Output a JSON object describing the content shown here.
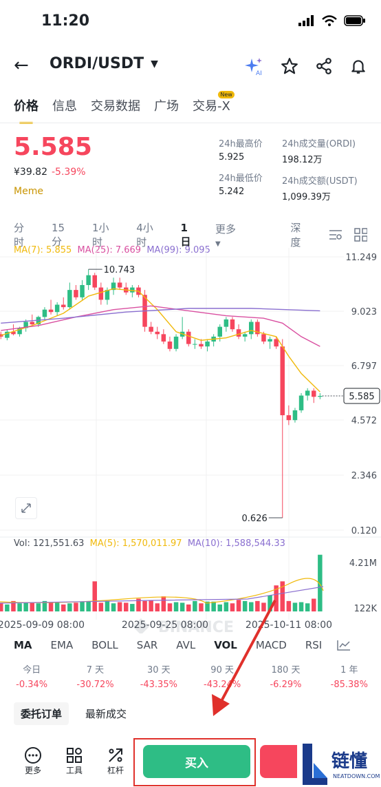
{
  "status": {
    "time": "11:20"
  },
  "header": {
    "pair": "ORDI/USDT"
  },
  "tabs": [
    {
      "label": "价格",
      "active": true
    },
    {
      "label": "信息"
    },
    {
      "label": "交易数据"
    },
    {
      "label": "广场"
    },
    {
      "label": "交易-X",
      "badge": "New"
    }
  ],
  "ticker": {
    "price": "5.585",
    "cny": "¥39.82",
    "change": "-5.39%",
    "tag": "Meme",
    "high_label": "24h最高价",
    "high": "5.925",
    "vol_label": "24h成交量(ORDI)",
    "vol": "198.12万",
    "low_label": "24h最低价",
    "low": "5.242",
    "amt_label": "24h成交额(USDT)",
    "amt": "1,099.39万"
  },
  "intervals": [
    "分时",
    "15分",
    "1小时",
    "4小时",
    "1日",
    "更多",
    "深度"
  ],
  "active_interval": "1日",
  "ma": {
    "ma7": "MA(7): 5.855",
    "ma25": "MA(25): 7.669",
    "ma99": "MA(99): 9.095"
  },
  "vol_info": {
    "vol": "Vol: 121,551.63",
    "ma5": "MA(5): 1,570,011.97",
    "ma10": "MA(10): 1,588,544.33"
  },
  "chart_data": {
    "type": "candlestick",
    "y_ticks": [
      "11.249",
      "9.023",
      "6.797",
      "4.572",
      "2.346",
      "0.120"
    ],
    "high_marker": "10.743",
    "low_marker": "0.626",
    "last_price": "5.585",
    "watermark": "BINANCE",
    "vol_ticks": [
      "4.21M",
      "122K"
    ],
    "x_ticks": [
      "2025-09-09 08:00",
      "2025-09-25 08:00",
      "2025-10-11 08:00"
    ],
    "colors": {
      "up": "#2ebd85",
      "down": "#f6465d",
      "ma7": "#f0b90b",
      "ma25": "#d94fa0",
      "ma99": "#8a6fd0"
    }
  },
  "indicators": [
    "MA",
    "EMA",
    "BOLL",
    "SAR",
    "AVL",
    "VOL",
    "MACD",
    "RSI"
  ],
  "active_indicators": [
    "MA",
    "VOL"
  ],
  "periods": [
    {
      "label": "今日",
      "value": "-0.34%"
    },
    {
      "label": "7 天",
      "value": "-30.72%"
    },
    {
      "label": "30 天",
      "value": "-43.35%"
    },
    {
      "label": "90 天",
      "value": "-43.24%"
    },
    {
      "label": "180 天",
      "value": "-6.29%"
    },
    {
      "label": "1 年",
      "value": "-85.38%"
    }
  ],
  "order_tabs": [
    "委托订单",
    "最新成交"
  ],
  "bottom": {
    "more": "更多",
    "tools": "工具",
    "leverage": "杠杆",
    "buy": "买入"
  }
}
